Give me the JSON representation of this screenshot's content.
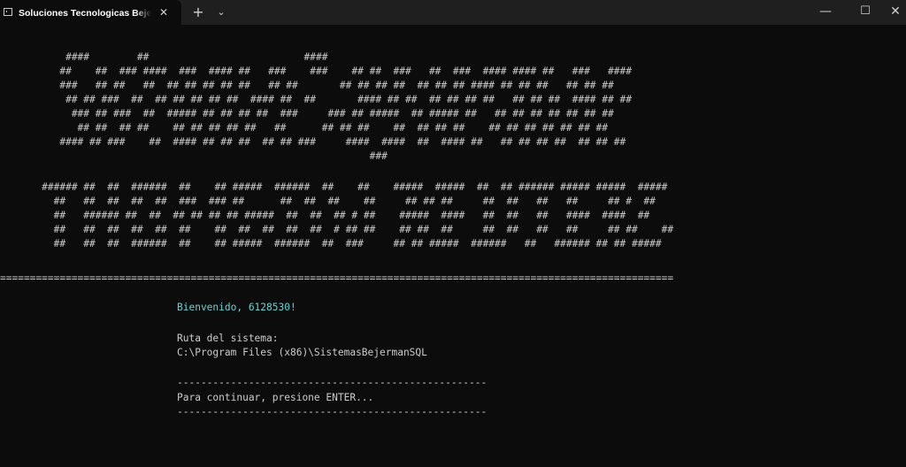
{
  "window": {
    "tab_title": "Soluciones Tecnologicas Bejerman",
    "tab_close": "✕",
    "new_tab": "+",
    "dropdown": "⌄",
    "minimize": "—",
    "maximize": "☐",
    "close": "✕"
  },
  "terminal": {
    "banner_top": [
      "           ####        ##                          ####",
      "          ##    ##  ### ####  ###  #### ##   ###    ###    ## ##  ###   ##  ###  #### #### ##   ###   ####",
      "          ###   ## ##   ##  ## ## ## ## ##   ## ##       ## ## ## ##  ## ## ## #### ## ## ##   ## ## ##",
      "           ## ## ###  ##  ## ## ## ## ##  #### ##  ##       #### ## ##  ## ## ## ##   ## ## ##  #### ## ##",
      "            ### ## ###  ##  ##### ## ## ## ##  ###     ### ## #####  ## ##### ##   ## ## ## ## ## ## ##",
      "             ## ##  ## ##    ## ## ## ## ##   ##      ## ## ##    ##  ## ## ##    ## ## ## ## ## ## ##",
      "          #### ## ###    ##  #### ## ## ##  ## ## ###     ####  ####  ##  #### ##   ## ## ## ##  ## ## ##",
      "                                                              ###"
    ],
    "banner_bottom": [
      "       ###### ##  ##  ######  ##    ## #####  ######  ##    ##    #####  #####  ##  ## ###### ##### #####  #####",
      "         ##   ##  ##  ##  ##  ###  ### ##      ##  ##  ##    ##     ## ## ##     ##  ##   ##   ##     ## #  ##",
      "         ##   ###### ##  ##  ## ## ## ## #####  ##  ##  ## # ##    #####  ####   ##  ##   ##   ####  ####  ##",
      "         ##   ##  ##  ##  ##  ##    ##  ##  ##  ##  ##  # ## ##    ## ##  ##     ##  ##   ##   ##     ## ##    ##",
      "         ##   ##  ##  ######  ##    ## #####  ######  ##  ###     ## ## #####  ######   ##   ###### ## ## #####"
    ],
    "separator": "=================================================================================================================",
    "welcome": "Bienvenido, 6128530!",
    "path_label": "Ruta del sistema:",
    "path_value": "C:\\Program Files (x86)\\SistemasBejermanSQL",
    "dash_line": "----------------------------------------------------",
    "prompt": "Para continuar, presione ENTER..."
  }
}
